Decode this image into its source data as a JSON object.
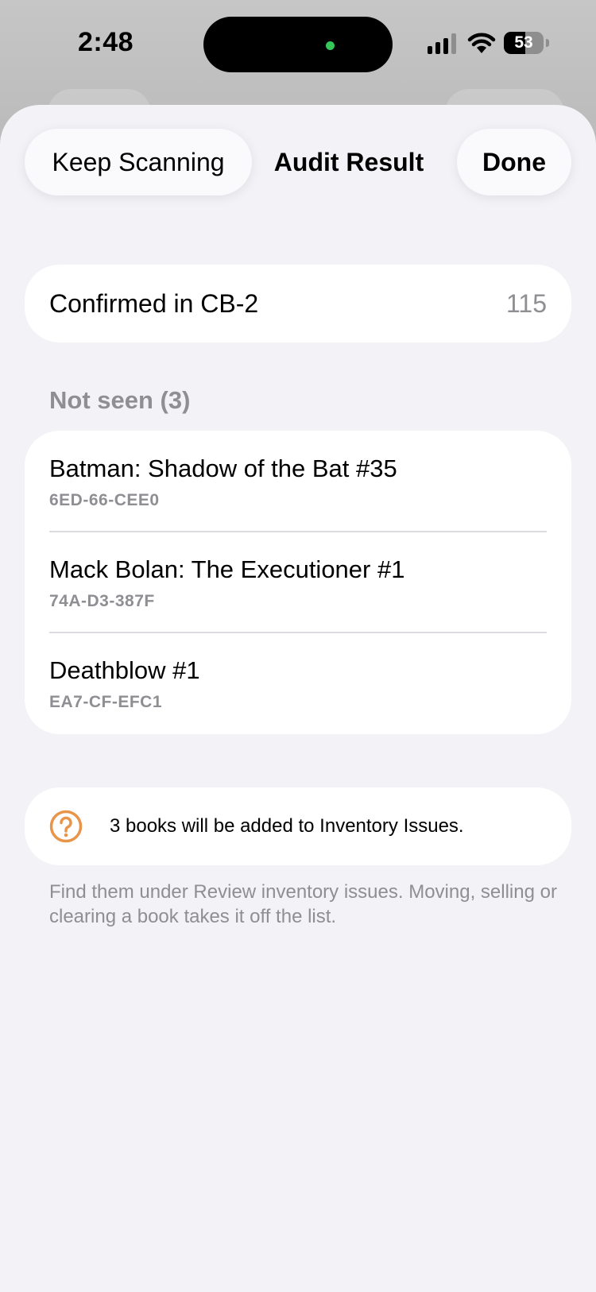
{
  "status_bar": {
    "time": "2:48",
    "battery": "53",
    "battery_level_percent": 53,
    "island_dot_color": "#35c759"
  },
  "header": {
    "keep_scanning_label": "Keep Scanning",
    "title": "Audit Result",
    "done_label": "Done"
  },
  "confirmed": {
    "label": "Confirmed in CB-2",
    "count": "115"
  },
  "not_seen": {
    "header": "Not seen (3)",
    "items": [
      {
        "title": "Batman: Shadow of the Bat #35",
        "code": "6ED-66-CEE0"
      },
      {
        "title": "Mack Bolan: The Executioner #1",
        "code": "74A-D3-387F"
      },
      {
        "title": "Deathblow #1",
        "code": "EA7-CF-EFC1"
      }
    ]
  },
  "notice": {
    "icon": "question-circle-icon",
    "icon_color": "#e8954a",
    "text": "3 books will be added to Inventory Issues.",
    "footnote": "Find them under Review inventory issues. Moving, selling or clearing a book takes it off the list."
  }
}
